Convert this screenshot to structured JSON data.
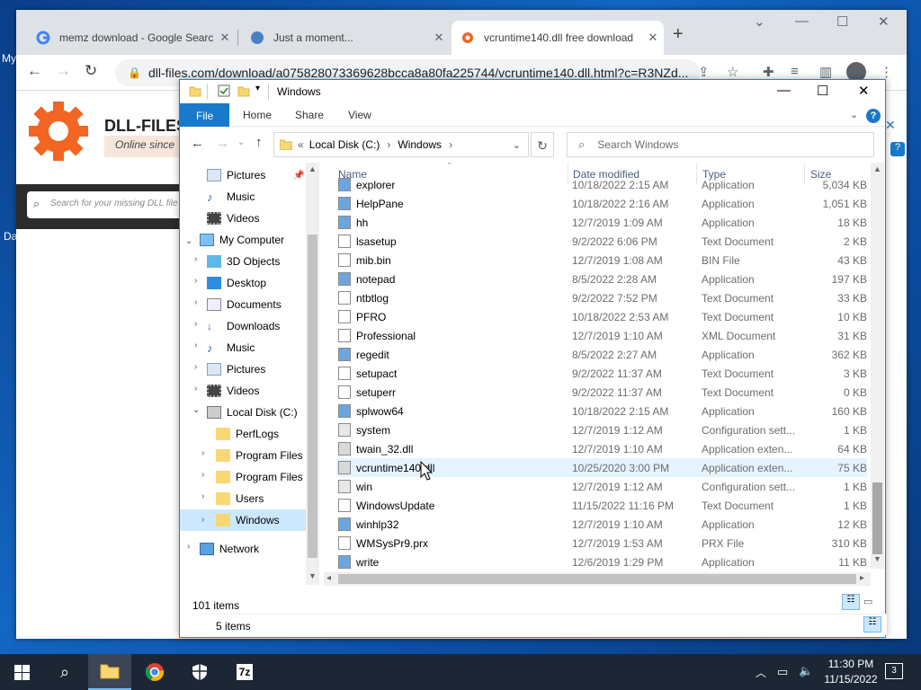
{
  "desktop": {
    "left_text_1": "My",
    "left_text_2": "Da"
  },
  "browser": {
    "tabs": [
      {
        "title": "memz download - Google Search",
        "close": "✕"
      },
      {
        "title": "Just a moment...",
        "close": "✕"
      },
      {
        "title": "vcruntime140.dll free download",
        "close": "✕"
      }
    ],
    "new_tab": "+",
    "url": "dll-files.com/download/a075828073369628bcca8a80fa225744/vcruntime140.dll.html?c=R3NZd..."
  },
  "site": {
    "logo_text": "DLL-FILES.",
    "tagline": "Online since",
    "search_placeholder": "Search for your missing DLL file"
  },
  "explorer": {
    "title": "Windows",
    "ribbon": {
      "file": "File",
      "home": "Home",
      "share": "Share",
      "view": "View"
    },
    "address": {
      "prefix": "«",
      "drive": "Local Disk (C:)",
      "sep": "›",
      "folder": "Windows"
    },
    "search_placeholder": "Search Windows",
    "nav": [
      {
        "label": "Pictures",
        "icon": "pictures-icon"
      },
      {
        "label": "Music",
        "icon": "music-icon"
      },
      {
        "label": "Videos",
        "icon": "videos-icon"
      },
      {
        "label": "My Computer",
        "icon": "computer-icon"
      },
      {
        "label": "3D Objects",
        "icon": "3d-objects-icon"
      },
      {
        "label": "Desktop",
        "icon": "desktop-icon"
      },
      {
        "label": "Documents",
        "icon": "documents-icon"
      },
      {
        "label": "Downloads",
        "icon": "downloads-icon"
      },
      {
        "label": "Music",
        "icon": "music-icon"
      },
      {
        "label": "Pictures",
        "icon": "pictures-icon"
      },
      {
        "label": "Videos",
        "icon": "videos-icon"
      },
      {
        "label": "Local Disk (C:)",
        "icon": "drive-icon"
      },
      {
        "label": "PerfLogs",
        "icon": "folder-icon"
      },
      {
        "label": "Program Files",
        "icon": "folder-icon"
      },
      {
        "label": "Program Files (",
        "icon": "folder-icon"
      },
      {
        "label": "Users",
        "icon": "folder-icon"
      },
      {
        "label": "Windows",
        "icon": "folder-icon"
      },
      {
        "label": "Network",
        "icon": "network-icon"
      }
    ],
    "columns": {
      "name": "Name",
      "date": "Date modified",
      "type": "Type",
      "size": "Size"
    },
    "files": [
      {
        "name": "explorer",
        "date": "10/18/2022 2:15 AM",
        "type": "Application",
        "size": "5,034 KB"
      },
      {
        "name": "HelpPane",
        "date": "10/18/2022 2:16 AM",
        "type": "Application",
        "size": "1,051 KB"
      },
      {
        "name": "hh",
        "date": "12/7/2019 1:09 AM",
        "type": "Application",
        "size": "18 KB"
      },
      {
        "name": "lsasetup",
        "date": "9/2/2022 6:06 PM",
        "type": "Text Document",
        "size": "2 KB"
      },
      {
        "name": "mib.bin",
        "date": "12/7/2019 1:08 AM",
        "type": "BIN File",
        "size": "43 KB"
      },
      {
        "name": "notepad",
        "date": "8/5/2022 2:28 AM",
        "type": "Application",
        "size": "197 KB"
      },
      {
        "name": "ntbtlog",
        "date": "9/2/2022 7:52 PM",
        "type": "Text Document",
        "size": "33 KB"
      },
      {
        "name": "PFRO",
        "date": "10/18/2022 2:53 AM",
        "type": "Text Document",
        "size": "10 KB"
      },
      {
        "name": "Professional",
        "date": "12/7/2019 1:10 AM",
        "type": "XML Document",
        "size": "31 KB"
      },
      {
        "name": "regedit",
        "date": "8/5/2022 2:27 AM",
        "type": "Application",
        "size": "362 KB"
      },
      {
        "name": "setupact",
        "date": "9/2/2022 11:37 AM",
        "type": "Text Document",
        "size": "3 KB"
      },
      {
        "name": "setuperr",
        "date": "9/2/2022 11:37 AM",
        "type": "Text Document",
        "size": "0 KB"
      },
      {
        "name": "splwow64",
        "date": "10/18/2022 2:15 AM",
        "type": "Application",
        "size": "160 KB"
      },
      {
        "name": "system",
        "date": "12/7/2019 1:12 AM",
        "type": "Configuration sett...",
        "size": "1 KB"
      },
      {
        "name": "twain_32.dll",
        "date": "12/7/2019 1:10 AM",
        "type": "Application exten...",
        "size": "64 KB"
      },
      {
        "name": "vcruntime140.dll",
        "date": "10/25/2020 3:00 PM",
        "type": "Application exten...",
        "size": "75 KB"
      },
      {
        "name": "win",
        "date": "12/7/2019 1:12 AM",
        "type": "Configuration sett...",
        "size": "1 KB"
      },
      {
        "name": "WindowsUpdate",
        "date": "11/15/2022 11:16 PM",
        "type": "Text Document",
        "size": "1 KB"
      },
      {
        "name": "winhlp32",
        "date": "12/7/2019 1:10 AM",
        "type": "Application",
        "size": "12 KB"
      },
      {
        "name": "WMSysPr9.prx",
        "date": "12/7/2019 1:53 AM",
        "type": "PRX File",
        "size": "310 KB"
      },
      {
        "name": "write",
        "date": "12/6/2019 1:29 PM",
        "type": "Application",
        "size": "11 KB"
      }
    ],
    "status_items": "101 items",
    "status_items_2": "5 items"
  },
  "taskbar": {
    "time": "11:30 PM",
    "date": "11/15/2022",
    "notif_count": "3",
    "app_7z": "7z"
  },
  "colors": {
    "accent": "#1979ca",
    "chrome_tabbar": "#dee1e6",
    "taskbar": "#1c2635",
    "dll_orange": "#f26522"
  }
}
